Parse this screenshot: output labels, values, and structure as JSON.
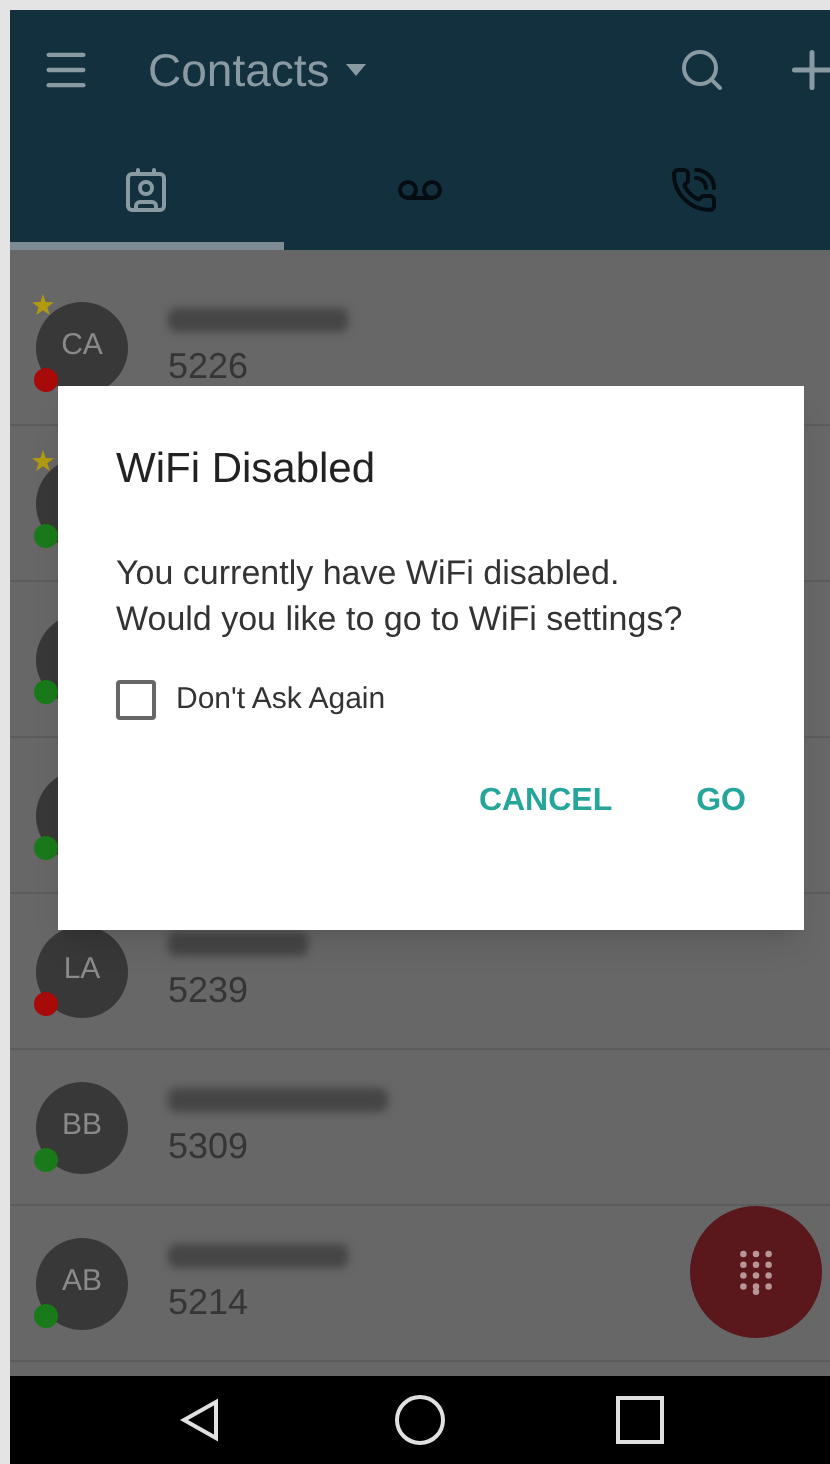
{
  "app_bar": {
    "title": "Contacts"
  },
  "tabs": [
    {
      "kind": "contacts",
      "selected": true
    },
    {
      "kind": "voicemail",
      "selected": false
    },
    {
      "kind": "calls",
      "selected": false
    }
  ],
  "contacts": [
    {
      "initials": "CA",
      "number": "5226",
      "starred": true,
      "color": "#a80a0a"
    },
    {
      "starred": true,
      "color": "#1a7a1a"
    },
    {
      "starred": false,
      "color": "#1a7a1a"
    },
    {
      "starred": false,
      "color": "#1a7a1a"
    },
    {
      "initials": "LA",
      "number": "5239",
      "starred": false,
      "color": "#a80a0a"
    },
    {
      "initials": "BB",
      "number": "5309",
      "starred": false,
      "color": "#1a7a1a"
    },
    {
      "initials": "AB",
      "number": "5214",
      "starred": false,
      "color": "#1a7a1a"
    }
  ],
  "dialog": {
    "title": "WiFi Disabled",
    "message": "You currently have WiFi disabled. Would you like to go to WiFi settings?",
    "checkbox": {
      "label": "Don't Ask Again",
      "checked": false
    },
    "buttons": [
      "CANCEL",
      "GO"
    ]
  }
}
